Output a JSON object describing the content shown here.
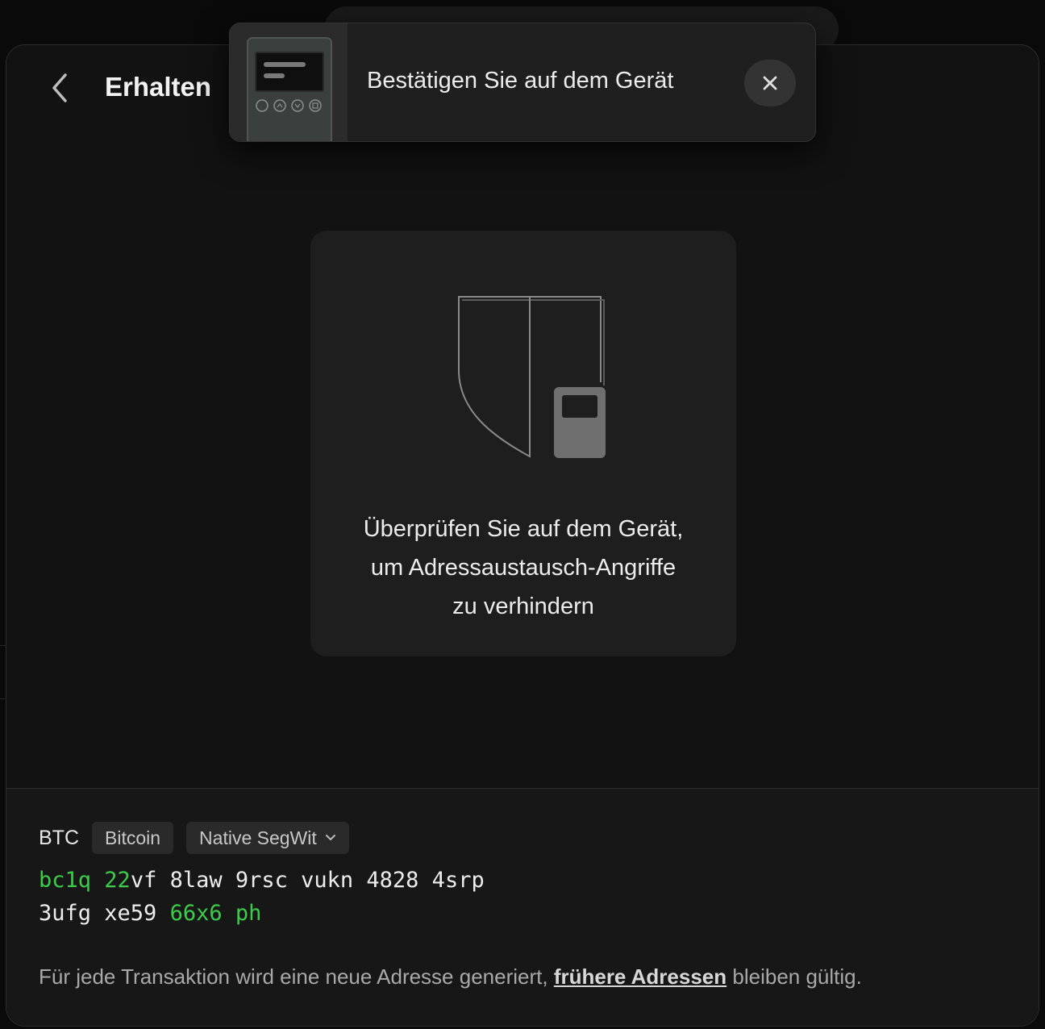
{
  "header": {
    "title": "Erhalten",
    "back_icon": "chevron-left-icon"
  },
  "toast": {
    "message": "Bestätigen Sie auf dem Gerät",
    "device_icon": "hardware-wallet-icon",
    "close_icon": "close-icon"
  },
  "card": {
    "illustration_icon": "shield-device-icon",
    "lines": [
      "Überprüfen Sie auf dem Gerät,",
      "um Adressaustausch-Angriffe",
      "zu verhindern"
    ]
  },
  "asset": {
    "symbol": "BTC",
    "network": "Bitcoin",
    "address_type": "Native SegWit",
    "dropdown_icon": "chevron-down-icon"
  },
  "address": {
    "line1": [
      {
        "text": "bc1q",
        "highlight": true
      },
      {
        "text": " ",
        "highlight": false
      },
      {
        "text": "22",
        "highlight": true
      },
      {
        "text": "vf 8law 9rsc vukn 4828 4srp",
        "highlight": false
      }
    ],
    "line2": [
      {
        "text": "3ufg xe59 ",
        "highlight": false
      },
      {
        "text": "66x6 ph",
        "highlight": true
      }
    ]
  },
  "hint": {
    "before": "Für jede Transaktion wird eine neue Adresse generiert, ",
    "link": "frühere Adressen",
    "after": " bleiben gültig."
  },
  "colors": {
    "accent_green": "#3dcc4a",
    "modal_bg": "#121212",
    "card_bg": "#1e1e1e"
  }
}
